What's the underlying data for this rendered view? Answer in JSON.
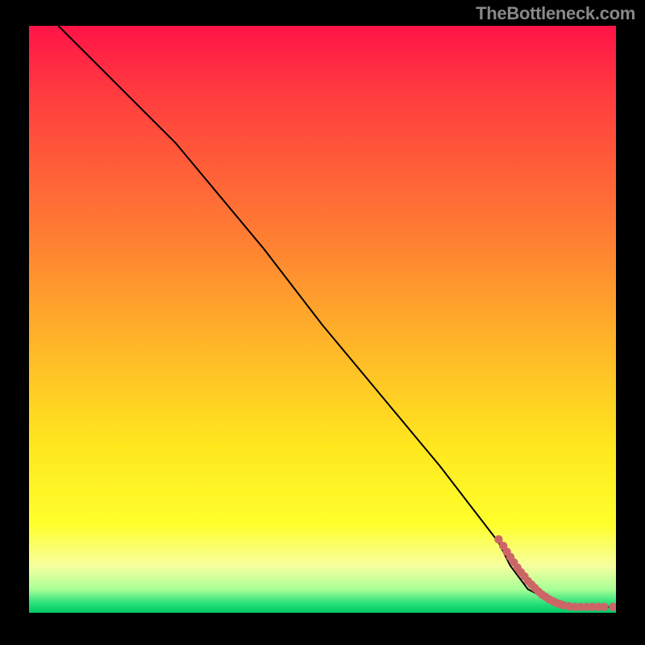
{
  "watermark": "TheBottleneck.com",
  "chart_data": {
    "type": "line",
    "title": "",
    "xlabel": "",
    "ylabel": "",
    "xlim": [
      0,
      100
    ],
    "ylim": [
      0,
      100
    ],
    "series": [
      {
        "name": "curve",
        "style": "line",
        "x": [
          5,
          15,
          25,
          30,
          40,
          50,
          60,
          70,
          80,
          82,
          85,
          90,
          95,
          100
        ],
        "y": [
          100,
          90,
          80,
          74,
          62,
          49,
          37,
          25,
          12,
          8,
          4,
          1.5,
          1,
          1
        ]
      },
      {
        "name": "dots",
        "style": "scatter",
        "x": [
          80.0,
          80.8,
          81.4,
          82.0,
          82.6,
          83.2,
          83.8,
          84.4,
          85.0,
          85.6,
          86.2,
          86.8,
          87.4,
          88.0,
          88.6,
          89.2,
          89.8,
          90.4,
          91.0,
          92.0,
          93.0,
          94.0,
          95.0,
          96.0,
          97.0,
          98.0,
          99.5
        ],
        "y": [
          12.5,
          11.4,
          10.4,
          9.5,
          8.6,
          7.7,
          6.9,
          6.2,
          5.4,
          4.8,
          4.2,
          3.6,
          3.1,
          2.7,
          2.3,
          2.0,
          1.7,
          1.5,
          1.3,
          1.1,
          1.0,
          1.0,
          1.0,
          1.0,
          1.0,
          1.0,
          1.0
        ]
      }
    ],
    "colors": {
      "curve": "#000000",
      "dots": "#cc6666"
    }
  }
}
